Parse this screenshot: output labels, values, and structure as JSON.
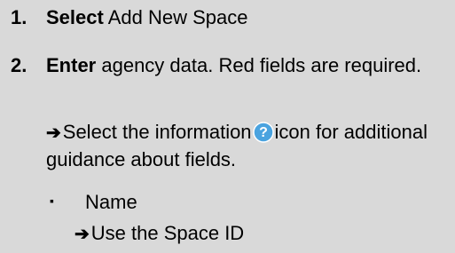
{
  "steps": [
    {
      "number": "1.",
      "action": "Select",
      "text": " Add New Space"
    },
    {
      "number": "2.",
      "action": "Enter",
      "text": " agency data. Red fields are required."
    }
  ],
  "note": {
    "before_icon": "Select the information",
    "icon": "info-question-icon",
    "after_icon": "icon for additional guidance about fields."
  },
  "bullet": {
    "marker": "▪",
    "label": "Name"
  },
  "sub_note": "Use the Space ID",
  "colors": {
    "background": "#d9d9d9",
    "icon_fill": "#4aa3df",
    "icon_stroke": "#ffffff"
  }
}
